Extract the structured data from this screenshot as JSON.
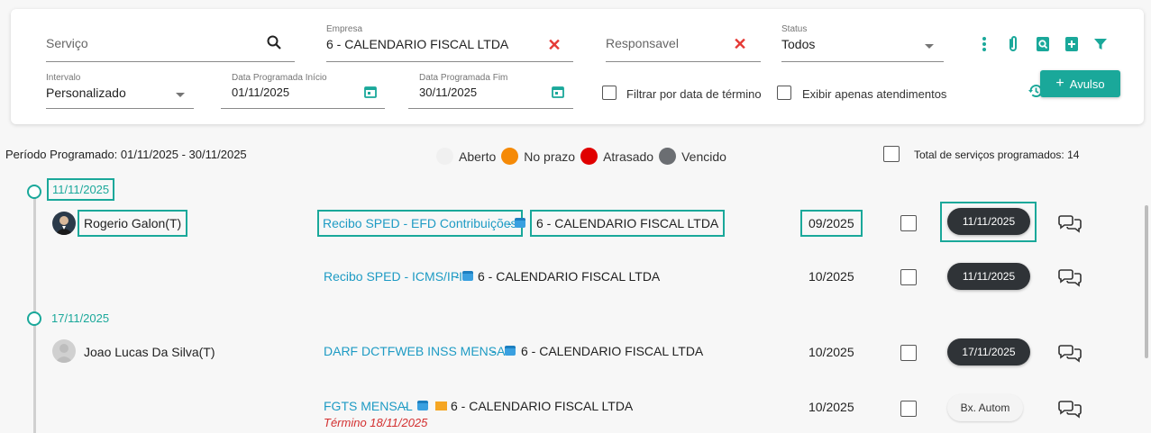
{
  "filters": {
    "servico": {
      "placeholder": "Serviço"
    },
    "empresa": {
      "label": "Empresa",
      "value": "6 - CALENDARIO FISCAL LTDA"
    },
    "responsavel": {
      "placeholder": "Responsavel"
    },
    "status": {
      "label": "Status",
      "value": "Todos"
    },
    "intervalo": {
      "label": "Intervalo",
      "value": "Personalizado"
    },
    "data_inicio": {
      "label": "Data Programada Início",
      "value": "01/11/2025"
    },
    "data_fim": {
      "label": "Data Programada Fim",
      "value": "30/11/2025"
    },
    "filtrar_termino": "Filtrar por data de término",
    "exibir_atendimentos": "Exibir apenas atendimentos",
    "avulso_label": "Avulso",
    "avulso_icon": "+"
  },
  "summary": {
    "periodo": "Período Programado: 01/11/2025 - 30/11/2025",
    "total": "Total de serviços programados: 14"
  },
  "legend": [
    {
      "label": "Aberto",
      "color": "#f0f0f0"
    },
    {
      "label": "No prazo",
      "color": "#f58a07"
    },
    {
      "label": "Atrasado",
      "color": "#e00000"
    },
    {
      "label": "Vencido",
      "color": "#6b6e72"
    }
  ],
  "groups": [
    {
      "date": "11/11/2025",
      "rows": [
        {
          "person": "Rogerio Galon(T)",
          "service": "Recibo SPED - EFD Contribuições",
          "company": "6 - CALENDARIO FISCAL LTDA",
          "competencia": "09/2025",
          "status_date": "11/11/2025"
        },
        {
          "person": "",
          "service": "Recibo SPED - ICMS/IPI",
          "company": "6 - CALENDARIO FISCAL LTDA",
          "competencia": "10/2025",
          "status_date": "11/11/2025"
        }
      ]
    },
    {
      "date": "17/11/2025",
      "rows": [
        {
          "person": "Joao Lucas Da Silva(T)",
          "service": "DARF DCTFWEB INSS MENSAL",
          "company": "6 - CALENDARIO FISCAL LTDA",
          "competencia": "10/2025",
          "status_date": "17/11/2025"
        },
        {
          "person": "",
          "service": "FGTS MENSAL",
          "company": "6 - CALENDARIO FISCAL LTDA",
          "competencia": "10/2025",
          "status_date": "Bx. Autom",
          "termino": "Término 18/11/2025"
        }
      ]
    }
  ],
  "sep": " - ",
  "colors": {
    "accent": "#1aa89a",
    "link": "#1e9bc4",
    "danger": "#e53935"
  }
}
